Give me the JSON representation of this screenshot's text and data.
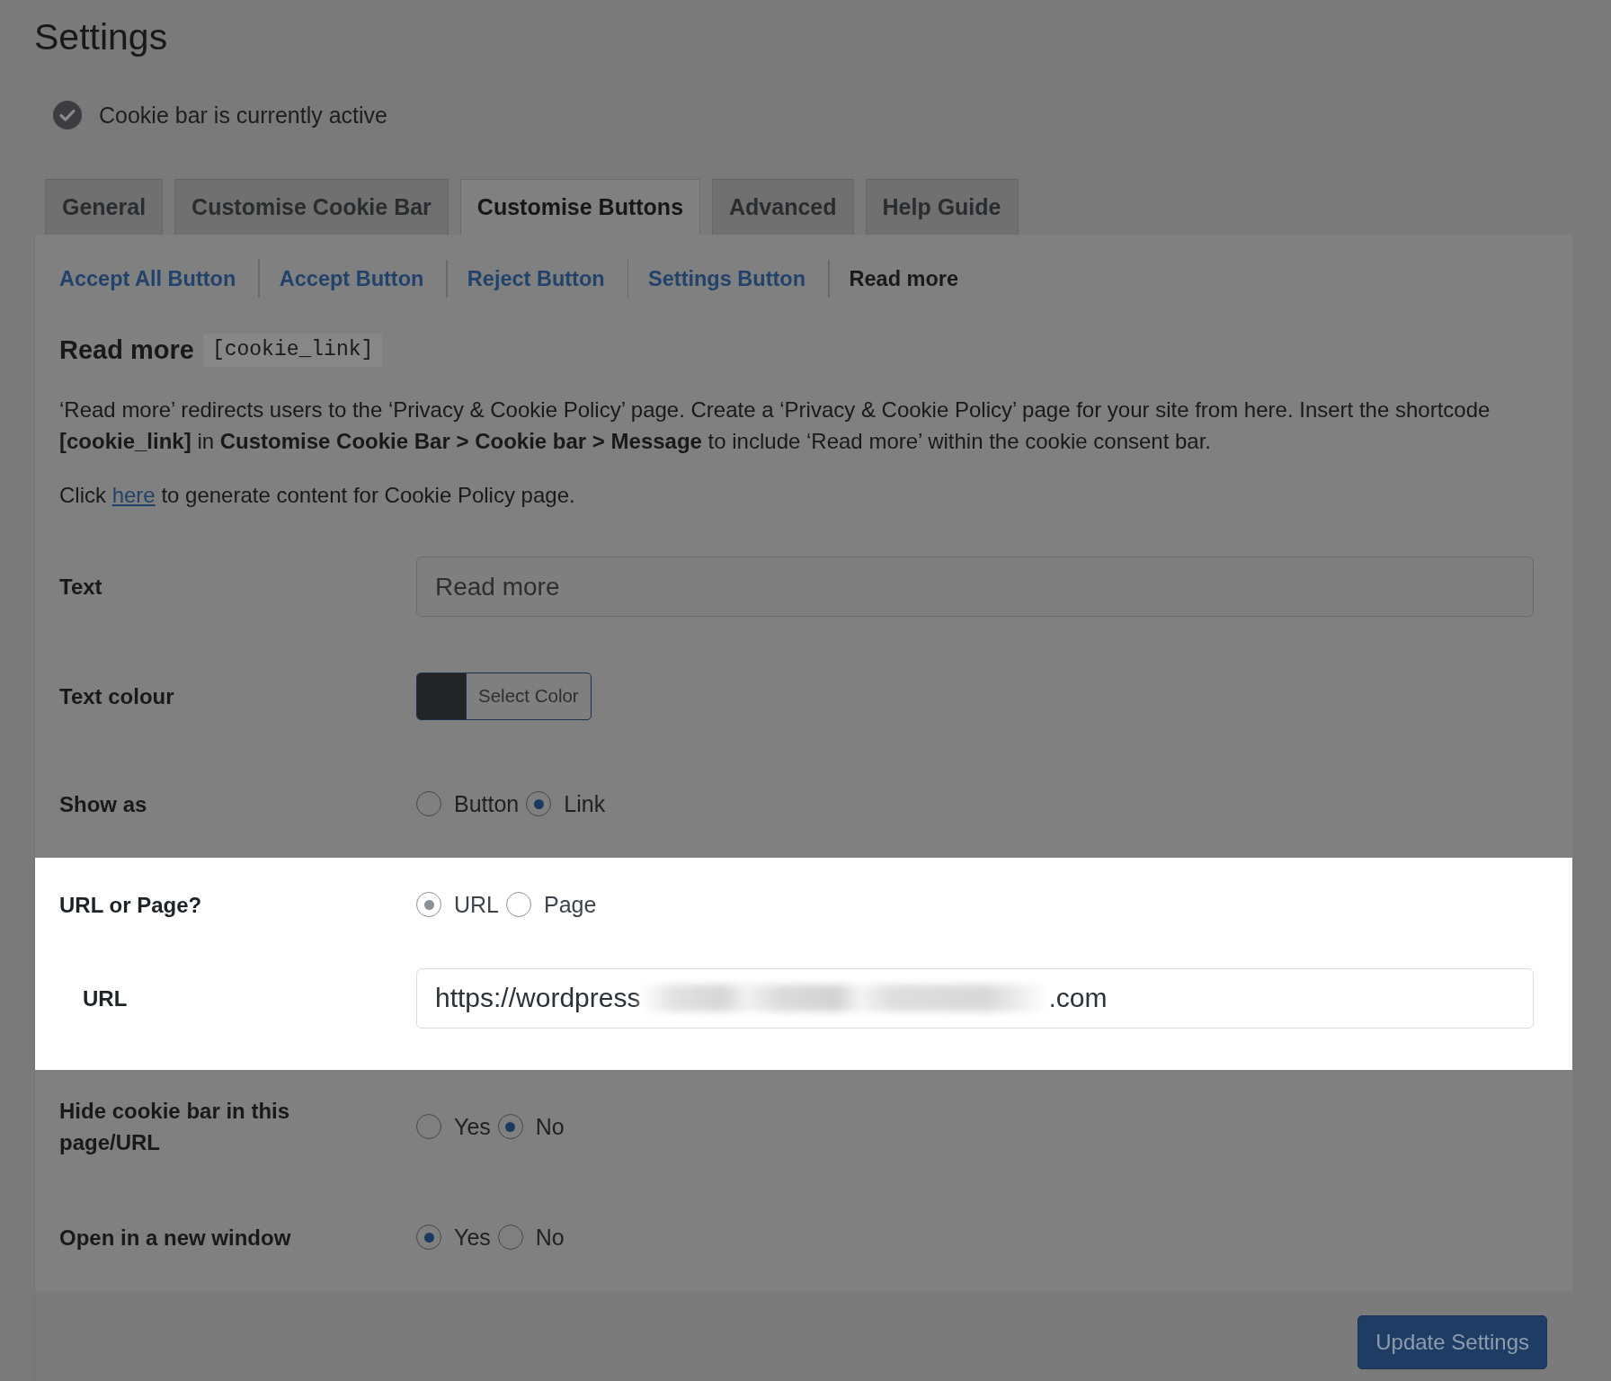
{
  "page": {
    "title": "Settings"
  },
  "status": {
    "text": "Cookie bar is currently active"
  },
  "tabs": [
    {
      "label": "General",
      "selected": false
    },
    {
      "label": "Customise Cookie Bar",
      "selected": false
    },
    {
      "label": "Customise Buttons",
      "selected": true
    },
    {
      "label": "Advanced",
      "selected": false
    },
    {
      "label": "Help Guide",
      "selected": false
    }
  ],
  "subtabs": [
    {
      "label": "Accept All Button",
      "selected": false
    },
    {
      "label": "Accept Button",
      "selected": false
    },
    {
      "label": "Reject Button",
      "selected": false
    },
    {
      "label": "Settings Button",
      "selected": false
    },
    {
      "label": "Read more",
      "selected": true
    }
  ],
  "section": {
    "heading": "Read more",
    "shortcode": "[cookie_link]",
    "description": "‘Read more’ redirects users to the ‘Privacy & Cookie Policy’ page. Create a ‘Privacy & Cookie Policy’ page for your site from here. Insert the shortcode **[cookie_link]** in **Customise Cookie Bar > Cookie bar > Message** to include ‘Read more’ within the cookie consent bar.",
    "note": {
      "before": "Click",
      "link": "here",
      "after": "to generate content for Cookie Policy page."
    }
  },
  "fields": [
    {
      "kind": "text",
      "label": "Text",
      "value": "Read more",
      "highlighted": false
    },
    {
      "kind": "color",
      "label": "Text colour",
      "color": "#222426",
      "button": "Select Color",
      "highlighted": false
    },
    {
      "kind": "radio",
      "label": "Show as",
      "highlighted": false,
      "options": [
        {
          "label": "Button",
          "selected": false
        },
        {
          "label": "Link",
          "selected": true
        }
      ]
    },
    {
      "kind": "radio",
      "label": "URL or Page?",
      "highlighted": true,
      "options": [
        {
          "label": "URL",
          "selected": true,
          "disabled": true
        },
        {
          "label": "Page",
          "selected": false,
          "disabled": false
        }
      ],
      "children": [
        {
          "kind": "url",
          "label": "URL",
          "value_start": "https://wordpress",
          "value_end": ".com",
          "redacted": true
        }
      ]
    },
    {
      "kind": "radio",
      "label": "Hide cookie bar in this page/URL",
      "highlighted": false,
      "options": [
        {
          "label": "Yes",
          "selected": false
        },
        {
          "label": "No",
          "selected": true
        }
      ]
    },
    {
      "kind": "radio",
      "label": "Open in a new window",
      "highlighted": false,
      "options": [
        {
          "label": "Yes",
          "selected": true
        },
        {
          "label": "No",
          "selected": false
        }
      ]
    }
  ],
  "submit": {
    "label": "Update Settings"
  }
}
